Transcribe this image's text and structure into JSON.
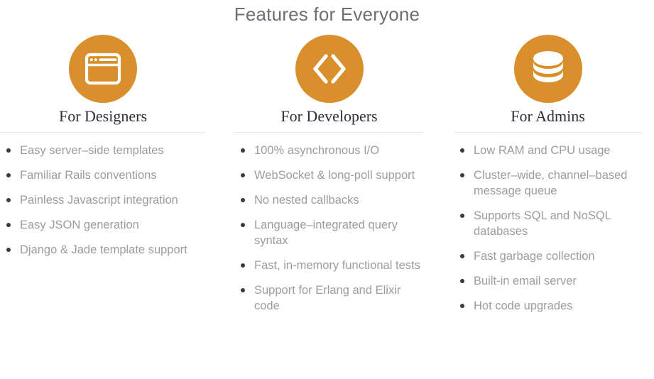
{
  "header": {
    "title": "Features for Everyone"
  },
  "theme": {
    "accent": "#d98f2b",
    "heading_color": "#2f2f3c",
    "body_text_color": "#9c9c9c",
    "title_color": "#6e6e76",
    "divider_color": "#e8e8e8",
    "bullet_color": "#3a3a3a",
    "background": "#ffffff"
  },
  "columns": [
    {
      "icon": "browser-window-icon",
      "heading": "For Designers",
      "items": [
        "Easy server–side templates",
        "Familiar Rails conventions",
        "Painless Javascript integration",
        "Easy JSON generation",
        "Django & Jade template support"
      ]
    },
    {
      "icon": "code-brackets-icon",
      "heading": "For Developers",
      "items": [
        "100% asynchronous I/O",
        "WebSocket & long-poll support",
        "No nested callbacks",
        "Language–integrated query syntax",
        "Fast, in-memory functional tests",
        "Support for Erlang and Elixir code"
      ]
    },
    {
      "icon": "database-icon",
      "heading": "For Admins",
      "items": [
        "Low RAM and CPU usage",
        "Cluster–wide, channel–based message queue",
        "Supports SQL and NoSQL databases",
        "Fast garbage collection",
        "Built-in email server",
        "Hot code upgrades"
      ]
    }
  ]
}
